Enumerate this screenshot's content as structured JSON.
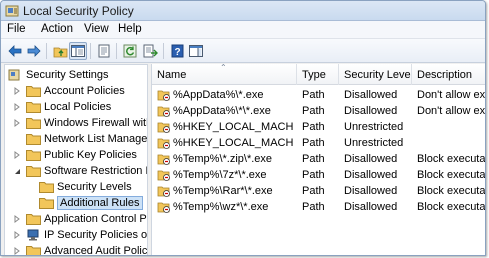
{
  "window": {
    "title": "Local Security Policy"
  },
  "menu": [
    "File",
    "Action",
    "View",
    "Help"
  ],
  "tree": {
    "items": [
      {
        "label": "Security Settings"
      },
      {
        "label": "Account Policies"
      },
      {
        "label": "Local Policies"
      },
      {
        "label": "Windows Firewall with A"
      },
      {
        "label": "Network List Manager P"
      },
      {
        "label": "Public Key Policies"
      },
      {
        "label": "Software Restriction Pol"
      },
      {
        "label": "Security Levels"
      },
      {
        "label": "Additional Rules"
      },
      {
        "label": "Application Control Pol"
      },
      {
        "label": "IP Security Policies on Lo"
      },
      {
        "label": "Advanced Audit Policy C"
      }
    ]
  },
  "list": {
    "columns": [
      "Name",
      "Type",
      "Security Level",
      "Description"
    ],
    "rows": [
      {
        "name": "%AppData%\\*.exe",
        "type": "Path",
        "level": "Disallowed",
        "description": "Don't allow exe"
      },
      {
        "name": "%AppData%\\*\\*.exe",
        "type": "Path",
        "level": "Disallowed",
        "description": "Don't allow exe"
      },
      {
        "name": "%HKEY_LOCAL_MACHINE...",
        "type": "Path",
        "level": "Unrestricted",
        "description": ""
      },
      {
        "name": "%HKEY_LOCAL_MACHINE...",
        "type": "Path",
        "level": "Unrestricted",
        "description": ""
      },
      {
        "name": "%Temp%\\*.zip\\*.exe",
        "type": "Path",
        "level": "Disallowed",
        "description": "Block executabl"
      },
      {
        "name": "%Temp%\\7z*\\*.exe",
        "type": "Path",
        "level": "Disallowed",
        "description": "Block executabl"
      },
      {
        "name": "%Temp%\\Rar*\\*.exe",
        "type": "Path",
        "level": "Disallowed",
        "description": "Block executabl"
      },
      {
        "name": "%Temp%\\wz*\\*.exe",
        "type": "Path",
        "level": "Disallowed",
        "description": "Block executabl"
      }
    ]
  },
  "icons": {
    "app": "security-policy-icon",
    "toolbar": [
      "back-arrow-icon",
      "forward-arrow-icon",
      "up-folder-icon",
      "show-hide-tree-icon",
      "properties-icon",
      "refresh-icon",
      "export-list-icon",
      "help-icon",
      "show-pane-icon"
    ]
  },
  "colors": {
    "accent": "#1e6fbf",
    "selection": "#cde2f7",
    "folder": "#f2c65a"
  }
}
